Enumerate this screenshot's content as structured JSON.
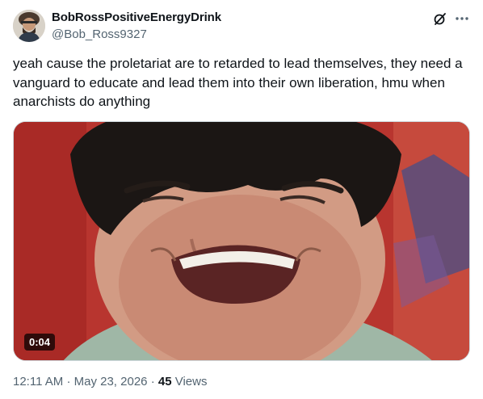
{
  "author": {
    "display_name": "BobRossPositiveEnergyDrink",
    "handle": "@Bob_Ross9327"
  },
  "tweet": {
    "text": "yeah cause the proletariat are to retarded to lead themselves, they need a vanguard to educate and lead them into their own liberation, hmu when anarchists do anything",
    "video_duration": "0:04",
    "time": "12:11 AM",
    "separator": "·",
    "date": "May 23, 2026",
    "views_count": "45",
    "views_label": "Views"
  },
  "icons": {
    "grok": "grok-slash-icon",
    "more": "more-horizontal-icon"
  },
  "colors": {
    "text_primary": "#0f1419",
    "text_secondary": "#536471",
    "border": "#cfd9de"
  }
}
